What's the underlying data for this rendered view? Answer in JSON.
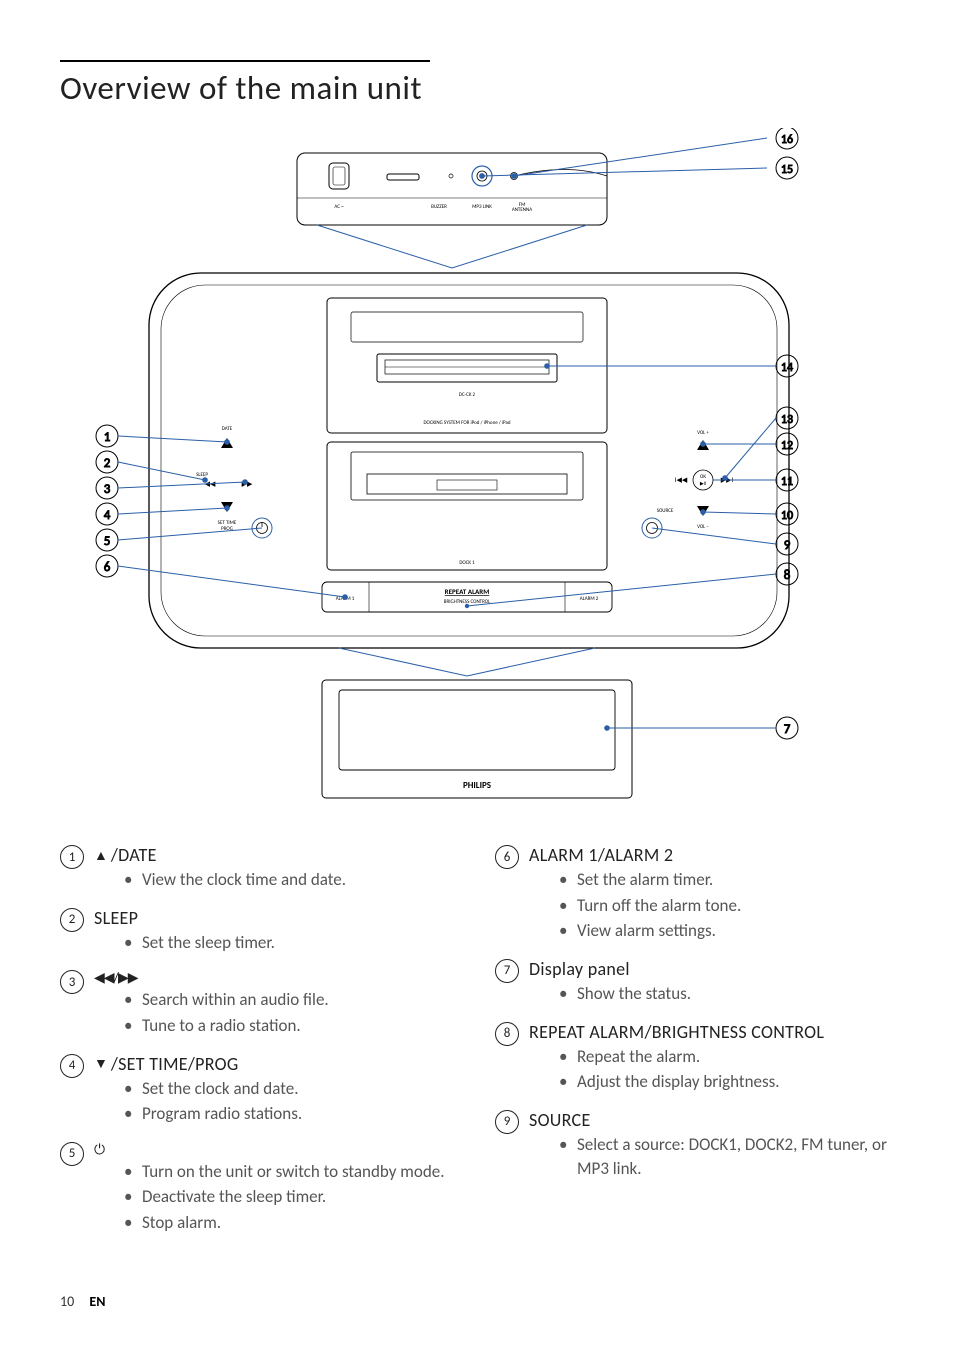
{
  "title": "Overview of the main unit",
  "footer": {
    "page": "10",
    "lang": "EN"
  },
  "diagram": {
    "rear_labels": {
      "ac": "AC ~",
      "buzzer": "BUZZER",
      "mp3": "MP3 LINK",
      "fm": "FM\nANTENNA"
    },
    "top_labels": {
      "model": "DC-CK 2",
      "system": "DOCKING SYSTEM FOR iPod / iPhone / iPad",
      "date": "DATE",
      "sleep": "SLEEP",
      "settime": "SET TIME\nPROG",
      "volplus": "VOL +",
      "okplay": "OK\n▶II",
      "source": "SOURCE",
      "volminus": "VOL –",
      "alarm1": "ALARM 1",
      "alarm2": "ALARM 2",
      "repeat": "REPEAT ALARM",
      "brightness": "BRIGHTNESS CONTROL",
      "dock1": "DOCK 1"
    },
    "front_label": "PHILIPS",
    "callouts_left": [
      "1",
      "2",
      "3",
      "4",
      "5",
      "6"
    ],
    "callouts_right": [
      "16",
      "15",
      "14",
      "13",
      "12",
      "11",
      "10",
      "9",
      "8",
      "7"
    ]
  },
  "left_items": [
    {
      "num": "1",
      "title_sym": "▲",
      "title_text": "/DATE",
      "bullets": [
        "View the clock time and date."
      ]
    },
    {
      "num": "2",
      "title_text": "SLEEP",
      "bullets": [
        "Set the sleep timer."
      ]
    },
    {
      "num": "3",
      "title_sym": "◀◀/▶▶",
      "title_text": "",
      "bullets": [
        "Search within an audio file.",
        "Tune to a radio station."
      ]
    },
    {
      "num": "4",
      "title_sym": "▼",
      "title_text": "/SET TIME/PROG",
      "bullets": [
        "Set the clock and date.",
        "Program radio stations."
      ]
    },
    {
      "num": "5",
      "title_sym": "⏻",
      "title_text": "",
      "bullets": [
        "Turn on the unit or switch to standby mode.",
        "Deactivate the sleep timer.",
        "Stop alarm."
      ]
    }
  ],
  "right_items": [
    {
      "num": "6",
      "title_text": "ALARM 1/ALARM 2",
      "bullets": [
        "Set the alarm timer.",
        "Turn off the alarm tone.",
        "View alarm settings."
      ]
    },
    {
      "num": "7",
      "title_text": "Display panel",
      "bullets": [
        "Show the status."
      ]
    },
    {
      "num": "8",
      "title_text": "REPEAT ALARM/BRIGHTNESS CONTROL",
      "bullets": [
        "Repeat the alarm.",
        "Adjust the display brightness."
      ]
    },
    {
      "num": "9",
      "title_text": "SOURCE",
      "bullets": [
        "Select a source: DOCK1, DOCK2, FM tuner, or MP3 link."
      ]
    }
  ]
}
